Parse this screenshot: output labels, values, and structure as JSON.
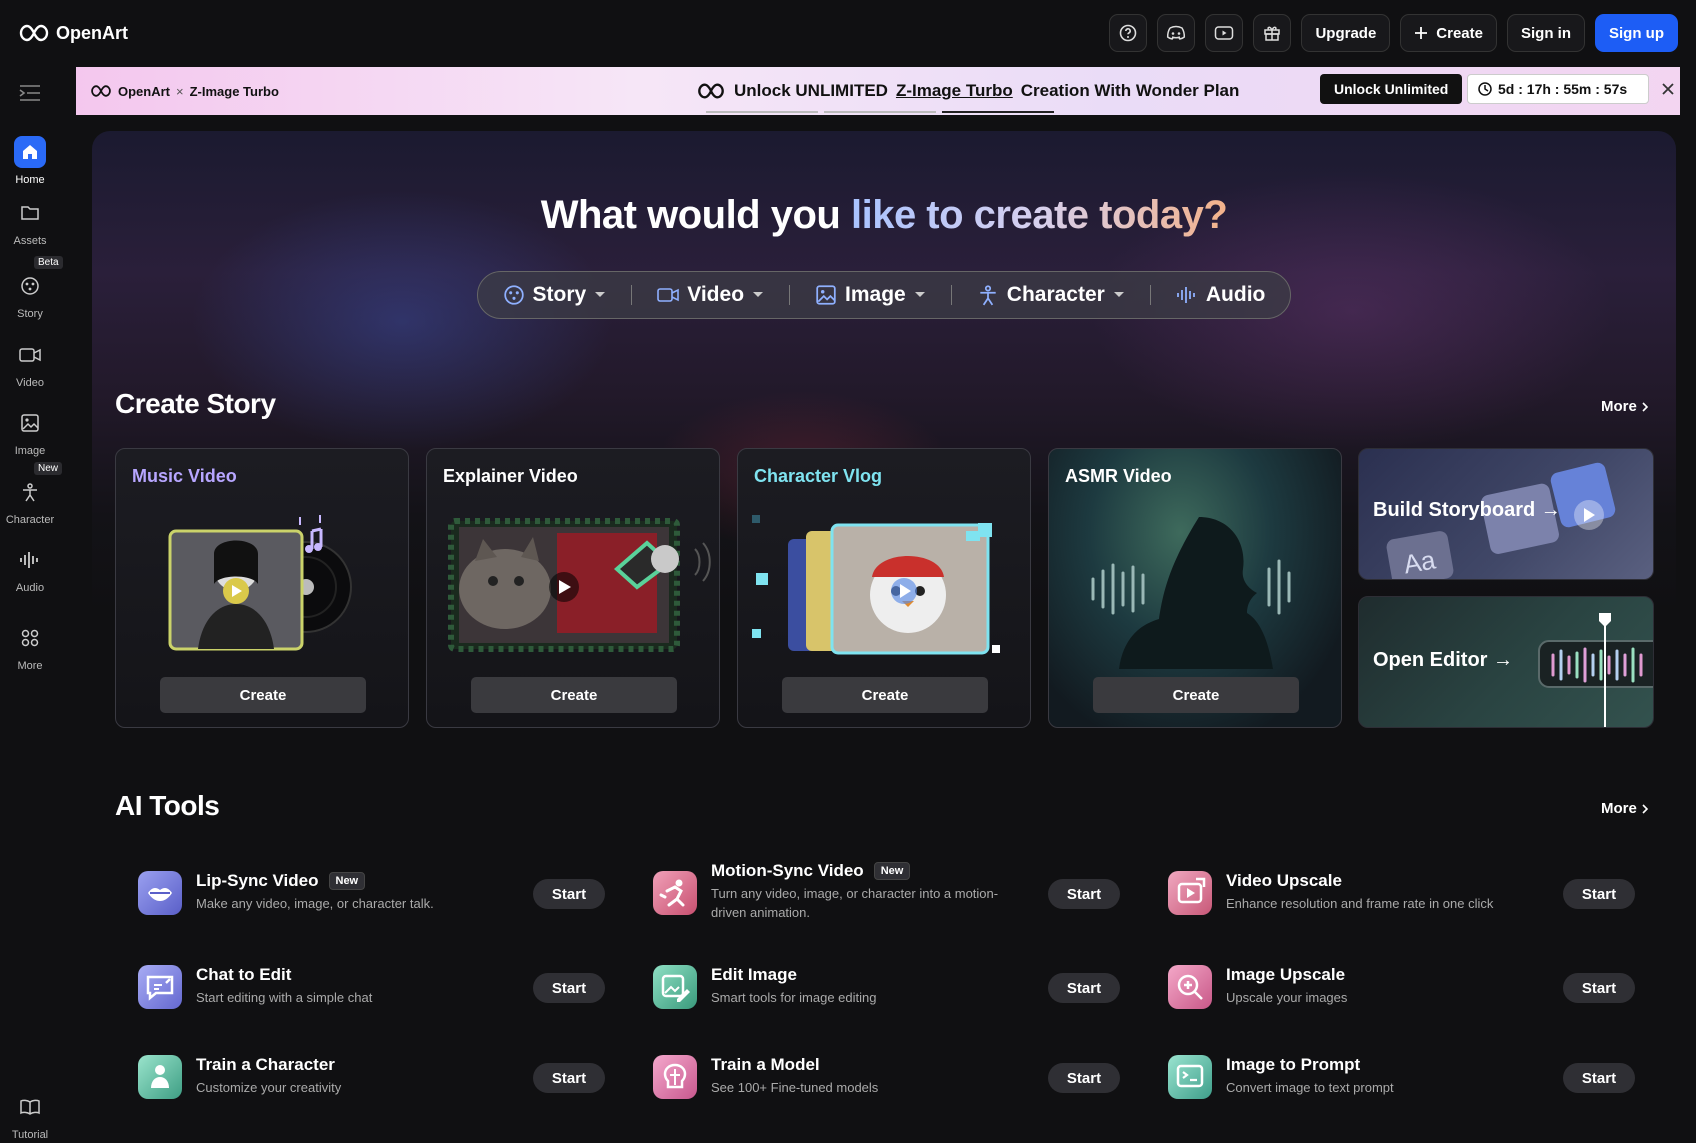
{
  "header": {
    "brand": "OpenArt",
    "help_icon": "help-icon",
    "discord_icon": "discord-icon",
    "youtube_icon": "youtube-icon",
    "gift_icon": "gift-icon",
    "upgrade_label": "Upgrade",
    "create_label": "Create",
    "signin_label": "Sign in",
    "signup_label": "Sign up"
  },
  "sidebar": {
    "items": [
      {
        "label": "Home",
        "icon": "home-icon"
      },
      {
        "label": "Assets",
        "icon": "folder-icon"
      },
      {
        "label": "Story",
        "icon": "story-icon",
        "badge": "Beta"
      },
      {
        "label": "Video",
        "icon": "video-icon"
      },
      {
        "label": "Image",
        "icon": "image-icon"
      },
      {
        "label": "Character",
        "icon": "character-icon",
        "badge": "New"
      },
      {
        "label": "Audio",
        "icon": "audio-icon"
      },
      {
        "label": "More",
        "icon": "grid-icon"
      }
    ],
    "tutorial_label": "Tutorial"
  },
  "promo": {
    "brand": "OpenArt",
    "separator": "×",
    "model": "Z-Image Turbo",
    "headline_pre": "Unlock UNLIMITED",
    "headline_link": "Z-Image Turbo",
    "headline_post": "Creation With Wonder Plan",
    "button": "Unlock Unlimited",
    "timer": "5d : 17h : 55m : 57s"
  },
  "hero": {
    "title_part1": "What would you",
    "title_part2": "like to create today?",
    "types": [
      {
        "label": "Story",
        "icon": "story-icon",
        "dropdown": true
      },
      {
        "label": "Video",
        "icon": "video-icon",
        "dropdown": true
      },
      {
        "label": "Image",
        "icon": "image-icon",
        "dropdown": true
      },
      {
        "label": "Character",
        "icon": "character-icon",
        "dropdown": true
      },
      {
        "label": "Audio",
        "icon": "audio-icon",
        "dropdown": false
      }
    ]
  },
  "create_story": {
    "title": "Create Story",
    "more": "More",
    "cards": [
      {
        "title": "Music Video",
        "title_color": "#b7a6ff",
        "button": "Create"
      },
      {
        "title": "Explainer Video",
        "title_color": "#ffffff",
        "button": "Create"
      },
      {
        "title": "Character Vlog",
        "title_color": "#7fe3f0",
        "button": "Create"
      },
      {
        "title": "ASMR Video",
        "title_color": "#ffffff",
        "button": "Create"
      }
    ],
    "build_storyboard": "Build Storyboard →",
    "open_editor": "Open Editor →",
    "storyboard_glyph": "Aa"
  },
  "ai_tools": {
    "title": "AI Tools",
    "more": "More",
    "tools": [
      {
        "name": "Lip-Sync Video",
        "badge": "New",
        "desc": "Make any video, image, or character talk.",
        "button": "Start",
        "icon": "lips-icon",
        "color": "#6b6fd8"
      },
      {
        "name": "Motion-Sync Video",
        "badge": "New",
        "desc": "Turn any video, image, or character into a motion-driven animation.",
        "button": "Start",
        "icon": "motion-icon",
        "color": "#d86b8a"
      },
      {
        "name": "Video Upscale",
        "badge": "",
        "desc": "Enhance resolution and frame rate in one click",
        "button": "Start",
        "icon": "video-upscale-icon",
        "color": "#d66b8e"
      },
      {
        "name": "Chat to Edit",
        "badge": "",
        "desc": "Start editing with a simple chat",
        "button": "Start",
        "icon": "chat-edit-icon",
        "color": "#7b7fe0"
      },
      {
        "name": "Edit Image",
        "badge": "",
        "desc": "Smart tools for image editing",
        "button": "Start",
        "icon": "edit-image-icon",
        "color": "#4fb89a"
      },
      {
        "name": "Image Upscale",
        "badge": "",
        "desc": "Upscale your images",
        "button": "Start",
        "icon": "image-upscale-icon",
        "color": "#d86b96"
      },
      {
        "name": "Train a Character",
        "badge": "",
        "desc": "Customize your creativity",
        "button": "Start",
        "icon": "train-character-icon",
        "color": "#4fb89a"
      },
      {
        "name": "Train a Model",
        "badge": "",
        "desc": "See 100+ Fine-tuned models",
        "button": "Start",
        "icon": "train-model-icon",
        "color": "#d86b9a"
      },
      {
        "name": "Image to Prompt",
        "badge": "",
        "desc": "Convert image to text prompt",
        "button": "Start",
        "icon": "image-prompt-icon",
        "color": "#4fb8a0"
      }
    ]
  }
}
